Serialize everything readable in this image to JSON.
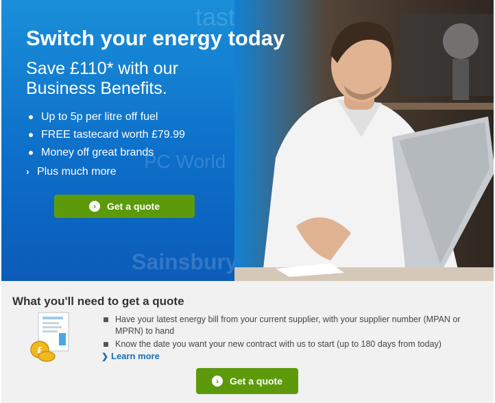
{
  "hero": {
    "watermark_top": "tastecard",
    "watermark_middle": "PC World",
    "watermark_bottom": "Sainsbury's",
    "title": "Switch your energy today",
    "subtitle": "Save £110* with our Business Benefits.",
    "benefits": [
      "Up to 5p per litre off fuel",
      "FREE tastecard worth £79.99",
      "Money off great brands"
    ],
    "more_label": "Plus much more",
    "cta_label": "Get a quote",
    "background_color": "#0d6fc9",
    "button_color": "#5c9a0c"
  },
  "quote_section": {
    "heading": "What you'll need to get a quote",
    "requirements": [
      "Have your latest energy bill from your current supplier, with your supplier number (MPAN or MPRN) to hand",
      "Know the date you want your new contract with us to start (up to 180 days from today)"
    ],
    "learn_more_label": "Learn more",
    "cta_label": "Get a quote"
  }
}
